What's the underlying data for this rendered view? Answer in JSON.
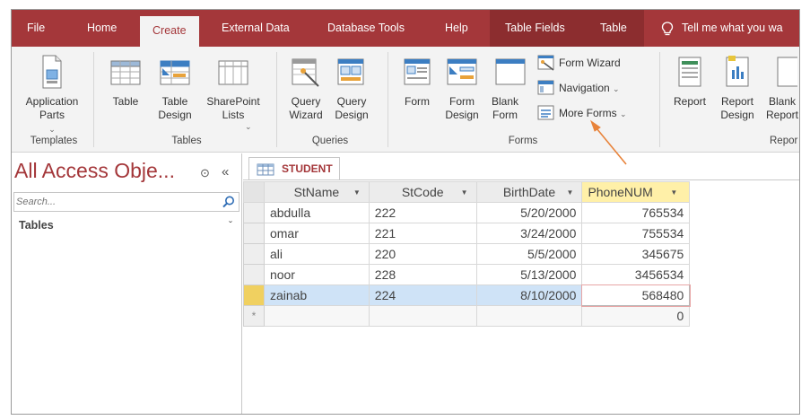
{
  "menu": {
    "tabs": [
      {
        "label": "File",
        "active": false
      },
      {
        "label": "Home",
        "active": false
      },
      {
        "label": "Create",
        "active": true
      },
      {
        "label": "External Data",
        "active": false
      },
      {
        "label": "Database Tools",
        "active": false
      },
      {
        "label": "Help",
        "active": false
      },
      {
        "label": "Table Fields",
        "active": false
      },
      {
        "label": "Table",
        "active": false
      }
    ],
    "tell_me": "Tell me what you wa"
  },
  "ribbon": {
    "templates": {
      "group_label": "Templates",
      "app_parts": "Application Parts"
    },
    "tables": {
      "group_label": "Tables",
      "table": "Table",
      "table_design": "Table Design",
      "sharepoint_lists": "SharePoint Lists"
    },
    "queries": {
      "group_label": "Queries",
      "query_wizard": "Query Wizard",
      "query_design": "Query Design"
    },
    "forms": {
      "group_label": "Forms",
      "form": "Form",
      "form_design": "Form Design",
      "blank_form": "Blank Form",
      "form_wizard": "Form Wizard",
      "navigation": "Navigation",
      "more_forms": "More Forms"
    },
    "reports": {
      "group_label": "Repor",
      "report": "Report",
      "report_design": "Report Design",
      "blank_report": "Blank Report"
    }
  },
  "nav_pane": {
    "title": "All Access Obje...",
    "search_placeholder": "Search...",
    "group": "Tables"
  },
  "document": {
    "tab_label": "STUDENT",
    "columns": [
      "StName",
      "StCode",
      "BirthDate",
      "PhoneNUM"
    ],
    "rows": [
      [
        "abdulla",
        "222",
        "5/20/2000",
        "765534"
      ],
      [
        "omar",
        "221",
        "3/24/2000",
        "755534"
      ],
      [
        "ali",
        "220",
        "5/5/2000",
        "345675"
      ],
      [
        "noor",
        "228",
        "5/13/2000",
        "3456534"
      ],
      [
        "zainab",
        "224",
        "8/10/2000",
        "568480"
      ]
    ],
    "new_row": {
      "marker": "*",
      "phone_default": "0"
    }
  },
  "colors": {
    "accent": "#a4373a",
    "context_tabs": "#8c2d2f",
    "ribbon_bg": "#f3f3f3",
    "selected_row": "#cfe3f7",
    "selected_header": "#fff0a8",
    "arrow": "#e8833a"
  }
}
